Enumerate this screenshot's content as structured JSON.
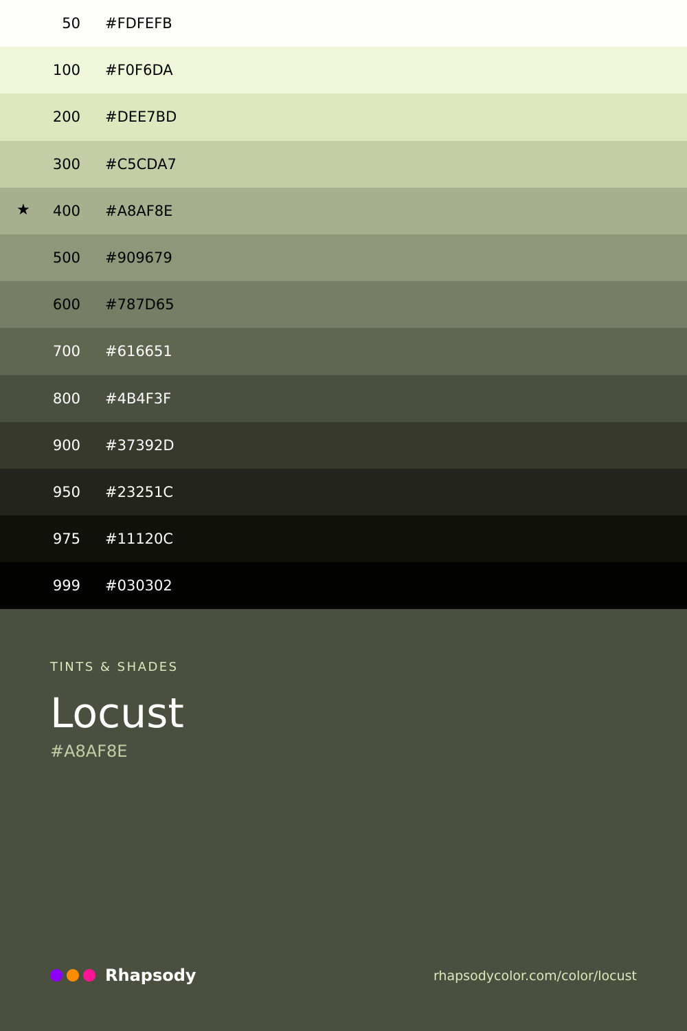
{
  "swatches": [
    {
      "step": "50",
      "hex": "#FDFEFB",
      "text_color": "#000000",
      "current": false
    },
    {
      "step": "100",
      "hex": "#F0F6DA",
      "text_color": "#000000",
      "current": false
    },
    {
      "step": "200",
      "hex": "#DEE7BD",
      "text_color": "#000000",
      "current": false
    },
    {
      "step": "300",
      "hex": "#C5CDA7",
      "text_color": "#000000",
      "current": false
    },
    {
      "step": "400",
      "hex": "#A8AF8E",
      "text_color": "#000000",
      "current": true
    },
    {
      "step": "500",
      "hex": "#909679",
      "text_color": "#000000",
      "current": false
    },
    {
      "step": "600",
      "hex": "#787D65",
      "text_color": "#000000",
      "current": false
    },
    {
      "step": "700",
      "hex": "#616651",
      "text_color": "#FFFFFF",
      "current": false
    },
    {
      "step": "800",
      "hex": "#4B4F3F",
      "text_color": "#FFFFFF",
      "current": false
    },
    {
      "step": "900",
      "hex": "#37392D",
      "text_color": "#FFFFFF",
      "current": false
    },
    {
      "step": "950",
      "hex": "#23251C",
      "text_color": "#FFFFFF",
      "current": false
    },
    {
      "step": "975",
      "hex": "#11120C",
      "text_color": "#FFFFFF",
      "current": false
    },
    {
      "step": "999",
      "hex": "#030302",
      "text_color": "#FFFFFF",
      "current": false
    }
  ],
  "current_marker": "★",
  "info": {
    "label": "TINTS & SHADES",
    "name": "Locust",
    "hex": "#A8AF8E"
  },
  "footer": {
    "brand": "Rhapsody",
    "brand_dot_colors": [
      "#8B00FF",
      "#FF8C00",
      "#FF1493"
    ],
    "url": "rhapsodycolor.com/color/locust"
  },
  "colors": {
    "background": "#4B4F3F",
    "label": "#DEE7BD",
    "hex_accent": "#C5CDA7"
  }
}
